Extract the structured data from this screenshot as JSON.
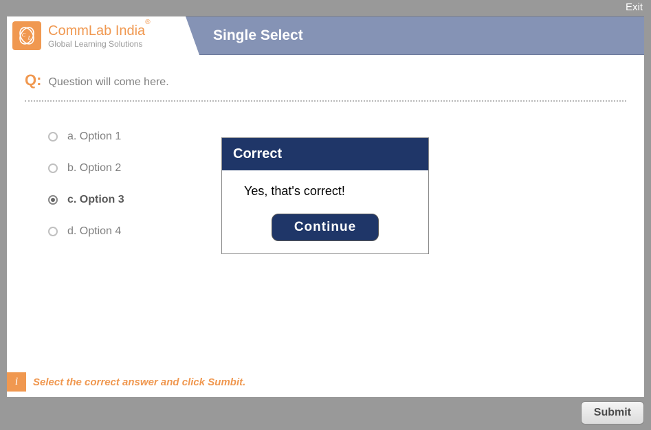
{
  "exit": "Exit",
  "brand": {
    "name": "CommLab India",
    "registered": "®",
    "tagline": "Global Learning Solutions"
  },
  "page_title": "Single Select",
  "question": {
    "label": "Q:",
    "text": "Question will come here."
  },
  "options": [
    {
      "letter": "a.",
      "text": "Option 1",
      "selected": false
    },
    {
      "letter": "b.",
      "text": "Option 2",
      "selected": false
    },
    {
      "letter": "c.",
      "text": "Option 3",
      "selected": true
    },
    {
      "letter": "d.",
      "text": "Option 4",
      "selected": false
    }
  ],
  "feedback": {
    "title": "Correct",
    "message": "Yes, that's correct!",
    "button": "Continue"
  },
  "instruction": {
    "icon": "i",
    "text": "Select the correct answer and click Sumbit."
  },
  "submit": "Submit"
}
